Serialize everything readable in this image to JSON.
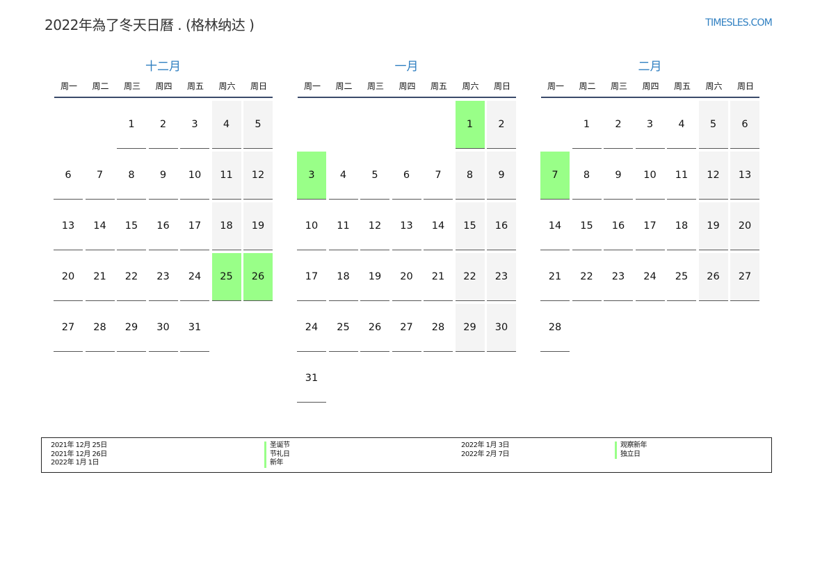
{
  "header": {
    "title": "2022年為了冬天日曆 . (格林纳达 )",
    "site": "TIMESLES.COM"
  },
  "weekday_labels": [
    "周一",
    "周二",
    "周三",
    "周四",
    "周五",
    "周六",
    "周日"
  ],
  "months": [
    {
      "name": "十二月",
      "offset": 2,
      "days": 31,
      "holidays": [
        25,
        26
      ]
    },
    {
      "name": "一月",
      "offset": 5,
      "days": 31,
      "holidays": [
        1,
        3
      ]
    },
    {
      "name": "二月",
      "offset": 1,
      "days": 28,
      "holidays": [
        7
      ]
    }
  ],
  "legend": [
    {
      "date": "2021年 12月 25日",
      "name": "圣诞节"
    },
    {
      "date": "2021年 12月 26日",
      "name": "节礼日"
    },
    {
      "date": "2022年 1月 1日",
      "name": "新年"
    },
    {
      "date": "2022年 1月 3日",
      "name": "观察新年"
    },
    {
      "date": "2022年 2月 7日",
      "name": "独立日"
    }
  ],
  "colors": {
    "holiday": "#99ff88",
    "weekend": "#f4f4f4",
    "accent": "#2f7fc1"
  }
}
